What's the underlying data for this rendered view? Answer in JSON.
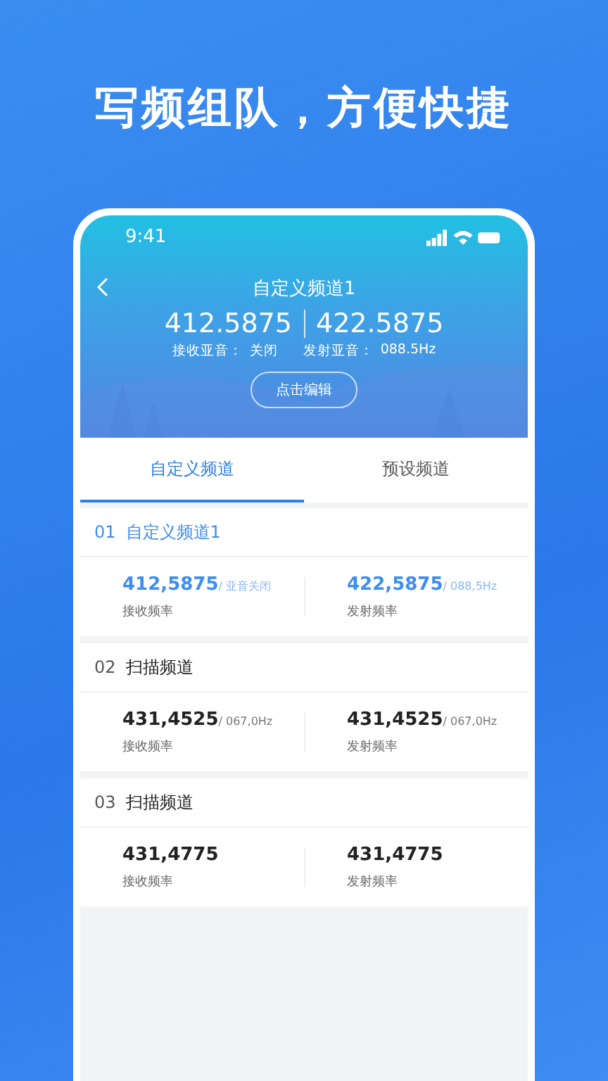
{
  "headline": "写频组队，方便快捷",
  "status_bar": {
    "time": "9:41"
  },
  "header": {
    "title": "自定义频道1",
    "rx_freq": "412.5875",
    "tx_freq": "422.5875",
    "rx_tone_label": "接收亚音：",
    "rx_tone": "关闭",
    "tx_tone_label": "发射亚音：",
    "tx_tone": "088.5Hz",
    "edit_button": "点击编辑"
  },
  "tabs": [
    {
      "label": "自定义频道",
      "selected": true
    },
    {
      "label": "预设频道",
      "selected": false
    }
  ],
  "channels": [
    {
      "index": "01",
      "name": "自定义频道1",
      "selected": true,
      "rx": {
        "freq": "412,5875",
        "tone": "/ 亚音关闭",
        "label": "接收频率"
      },
      "tx": {
        "freq": "422,5875",
        "tone": "/ 088,5Hz",
        "label": "发射频率"
      }
    },
    {
      "index": "02",
      "name": "扫描频道",
      "selected": false,
      "rx": {
        "freq": "431,4525",
        "tone": "/ 067,0Hz",
        "label": "接收频率"
      },
      "tx": {
        "freq": "431,4525",
        "tone": "/ 067,0Hz",
        "label": "发射频率"
      }
    },
    {
      "index": "03",
      "name": "扫描频道",
      "selected": false,
      "rx": {
        "freq": "431,4775",
        "label": "接收频率"
      },
      "tx": {
        "freq": "431,4775",
        "label": "发射频率"
      }
    }
  ]
}
